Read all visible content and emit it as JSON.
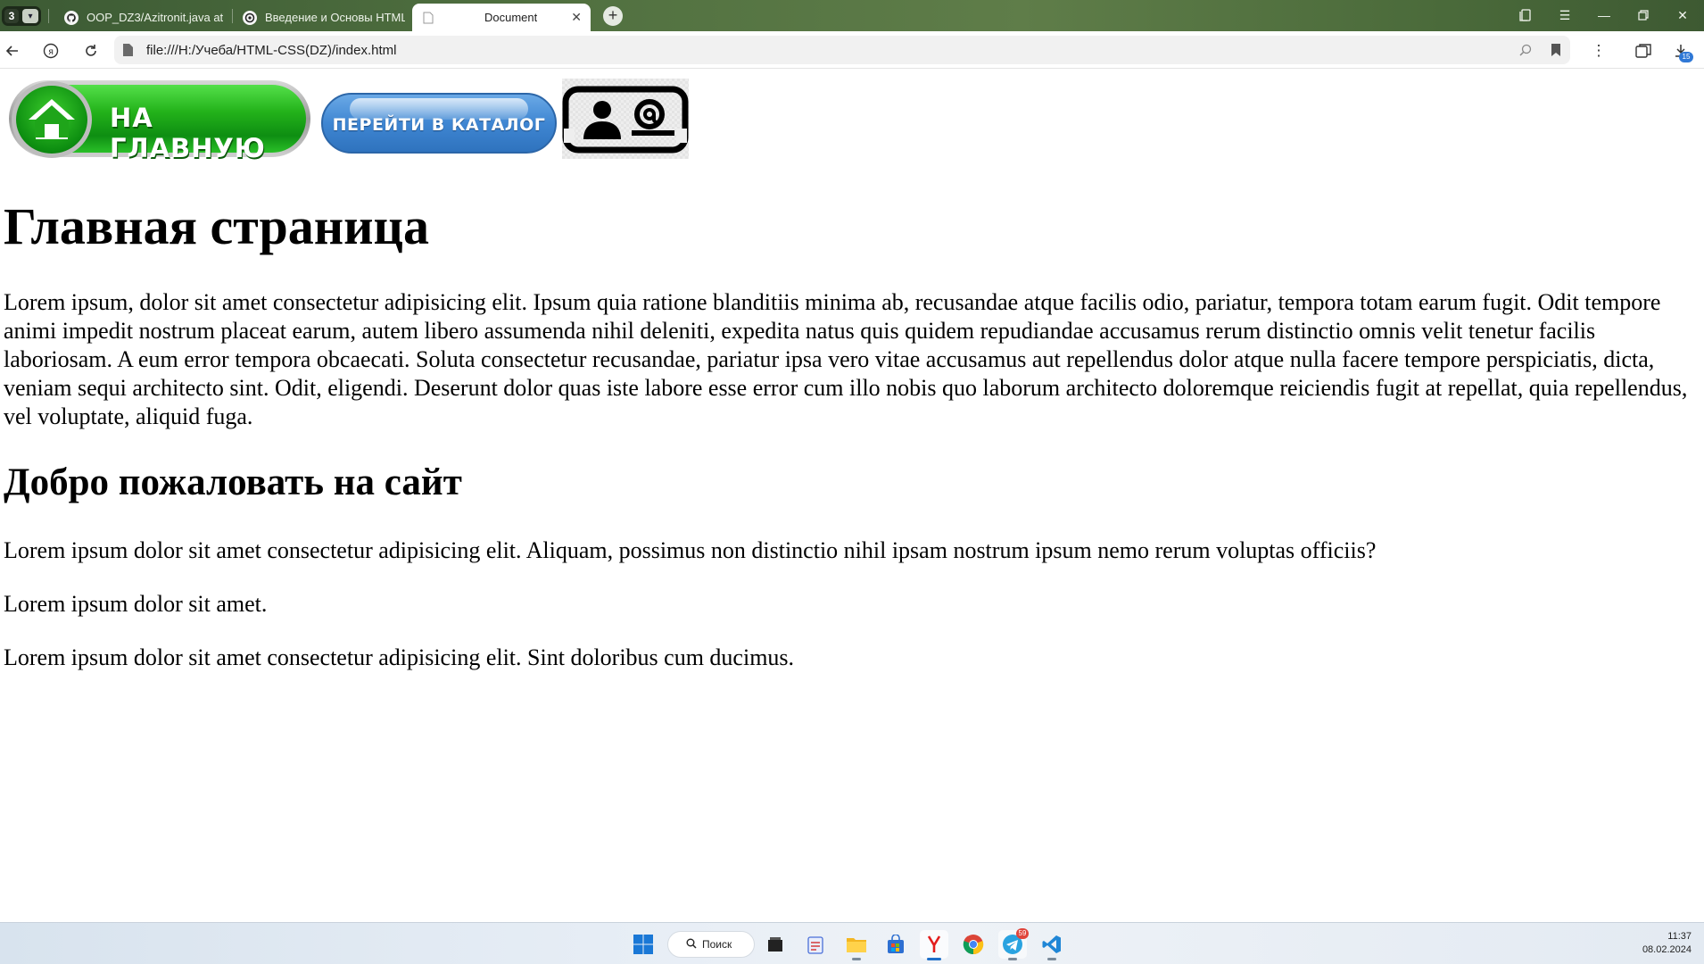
{
  "browser": {
    "tab_count": "3",
    "tabs": [
      {
        "title": "OOP_DZ3/Azitronit.java at",
        "icon": "github-icon"
      },
      {
        "title": "Введение и Основы HTML",
        "icon": "openai-icon"
      },
      {
        "title": "Document",
        "icon": "document-icon"
      }
    ],
    "address_url": "file:///H:/Учеба/HTML-CSS(DZ)/index.html",
    "download_badge": "15"
  },
  "page": {
    "nav": {
      "home_label": "НА ГЛАВНУЮ",
      "catalog_label": "ПЕРЕЙТИ В КАТАЛОГ"
    },
    "title": "Главная страница",
    "intro": "Lorem ipsum, dolor sit amet consectetur adipisicing elit. Ipsum quia ratione blanditiis minima ab, recusandae atque facilis odio, pariatur, tempora totam earum fugit. Odit tempore animi impedit nostrum placeat earum, autem libero assumenda nihil deleniti, expedita natus quis quidem repudiandae accusamus rerum distinctio omnis velit tenetur facilis laboriosam. A eum error tempora obcaecati. Soluta consectetur recusandae, pariatur ipsa vero vitae accusamus aut repellendus dolor atque nulla facere tempore perspiciatis, dicta, veniam sequi architecto sint. Odit, eligendi. Deserunt dolor quas iste labore esse error cum illo nobis quo laborum architecto doloremque reiciendis fugit at repellat, quia repellendus, vel voluptate, aliquid fuga.",
    "welcome": "Добро пожаловать на сайт",
    "paragraphs": [
      "Lorem ipsum dolor sit amet consectetur adipisicing elit. Aliquam, possimus non distinctio nihil ipsam nostrum ipsum nemo rerum voluptas officiis?",
      "Lorem ipsum dolor sit amet.",
      "Lorem ipsum dolor sit amet consectetur adipisicing elit. Sint doloribus cum ducimus."
    ]
  },
  "taskbar": {
    "search_label": "Поиск",
    "telegram_badge": "59",
    "time": "11:37",
    "date": "08.02.2024"
  }
}
